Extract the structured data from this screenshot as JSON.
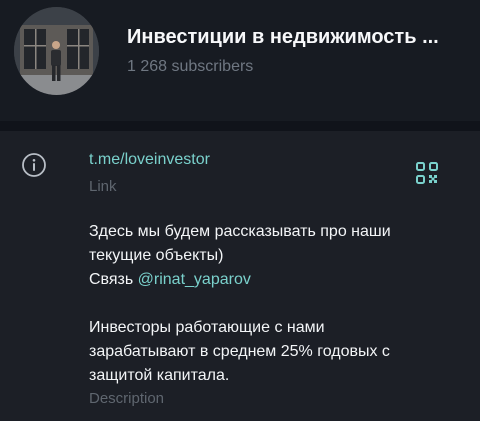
{
  "channel": {
    "title": "Инвестиции в недвижимость ...",
    "subscribers": "1 268 subscribers"
  },
  "info": {
    "link": "t.me/loveinvestor",
    "link_caption": "Link",
    "description_lines": [
      "Здесь мы будем рассказывать про наши",
      "текущие объекты)"
    ],
    "contact_prefix": "Связь ",
    "contact_mention": "@rinat_yaparov",
    "description_lines_2": [
      "Инвесторы работающие с нами",
      "зарабатывают в среднем 25% годовых с",
      "защитой капитала."
    ],
    "description_caption": "Description"
  },
  "icons": {
    "info": "info-icon",
    "qr": "qr-code-icon"
  },
  "colors": {
    "accent": "#7ad1cc",
    "background": "#1c1f26",
    "muted": "#6f7782"
  }
}
